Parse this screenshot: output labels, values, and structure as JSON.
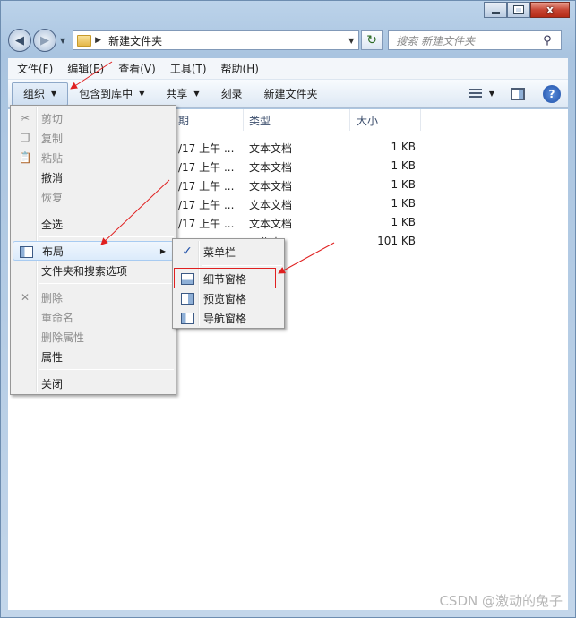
{
  "window": {
    "address": "新建文件夹",
    "search_placeholder": "搜索 新建文件夹",
    "caption_close": "x"
  },
  "menubar": [
    "文件(F)",
    "编辑(E)",
    "查看(V)",
    "工具(T)",
    "帮助(H)"
  ],
  "toolbar": {
    "organize": "组织",
    "include_library": "包含到库中",
    "share": "共享",
    "burn": "刻录",
    "new_folder": "新建文件夹",
    "help": "?"
  },
  "columns": {
    "date": "期",
    "type": "类型",
    "size": "大小"
  },
  "files": [
    {
      "date": "/17 上午 ...",
      "type": "文本文档",
      "size": "1 KB"
    },
    {
      "date": "/17 上午 ...",
      "type": "文本文档",
      "size": "1 KB"
    },
    {
      "date": "/17 上午 ...",
      "type": "文本文档",
      "size": "1 KB"
    },
    {
      "date": "/17 上午 ...",
      "type": "文本文档",
      "size": "1 KB"
    },
    {
      "date": "/17 上午 ...",
      "type": "文本文档",
      "size": "1 KB"
    },
    {
      "date": "",
      "type": "工作表",
      "size": "101 KB"
    }
  ],
  "organize_menu": {
    "cut": "剪切",
    "copy": "复制",
    "paste": "粘贴",
    "undo": "撤消",
    "redo": "恢复",
    "select_all": "全选",
    "layout": "布局",
    "folder_options": "文件夹和搜索选项",
    "delete": "删除",
    "rename": "重命名",
    "remove_properties": "删除属性",
    "properties": "属性",
    "close": "关闭"
  },
  "layout_menu": {
    "menu_bar": "菜单栏",
    "details_pane": "细节窗格",
    "preview_pane": "预览窗格",
    "navigation_pane": "导航窗格"
  },
  "watermark": "CSDN @激动的兔子",
  "colors": {
    "annotation": "#e02020",
    "highlight": "#a8cbf1"
  }
}
